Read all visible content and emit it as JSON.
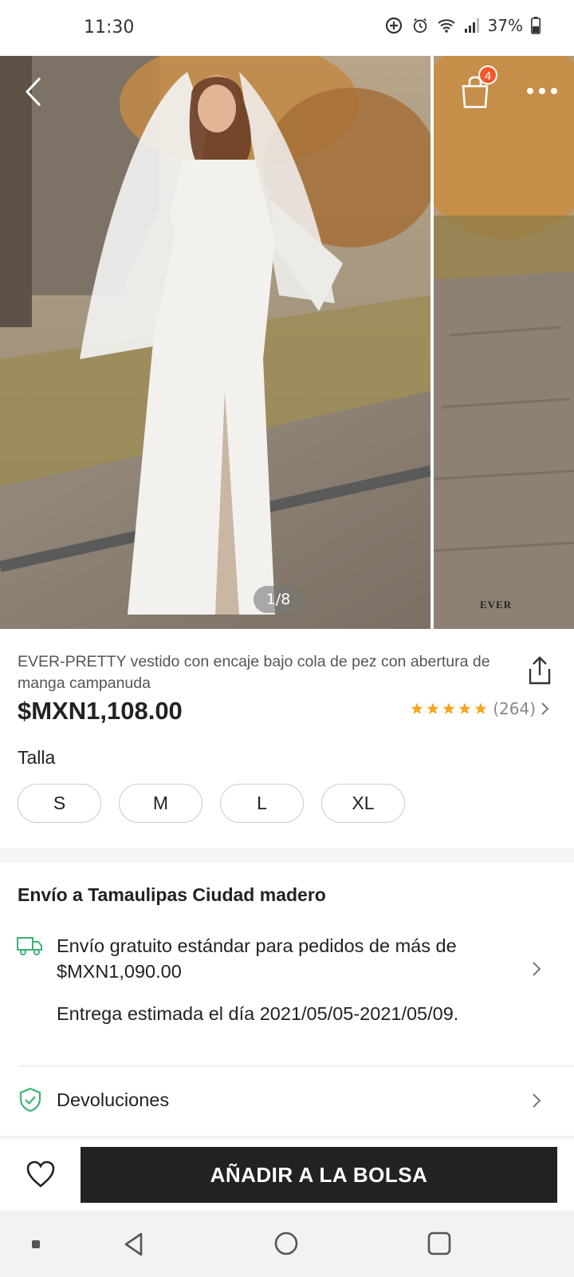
{
  "status_bar": {
    "time": "11:30",
    "battery": "37%",
    "icons": [
      "data-saver-icon",
      "alarm-icon",
      "wifi-icon",
      "signal-icon",
      "battery-icon"
    ]
  },
  "gallery": {
    "counter": "1/8",
    "cart_badge": "4",
    "watermark": "EVER"
  },
  "product": {
    "title": "EVER-PRETTY vestido con encaje bajo cola de pez con abertura de manga campanuda",
    "price": "$MXN1,108.00",
    "rating_count": "(264)",
    "rating_stars": 5,
    "size_label": "Talla",
    "sizes": [
      "S",
      "M",
      "L",
      "XL"
    ]
  },
  "shipping": {
    "heading": "Envío a Tamaulipas Ciudad madero",
    "free_shipping": "Envío gratuito estándar para pedidos de más de $MXN1,090.00",
    "delivery_estimate": "Entrega estimada el día 2021/05/05-2021/05/09.",
    "returns_label": "Devoluciones"
  },
  "actions": {
    "add_to_bag": "AÑADIR A LA BOLSA"
  },
  "colors": {
    "star": "#f5a623",
    "badge": "#f1582c",
    "truck": "#3cb371",
    "shield": "#3cb371",
    "button_bg": "#222222"
  }
}
